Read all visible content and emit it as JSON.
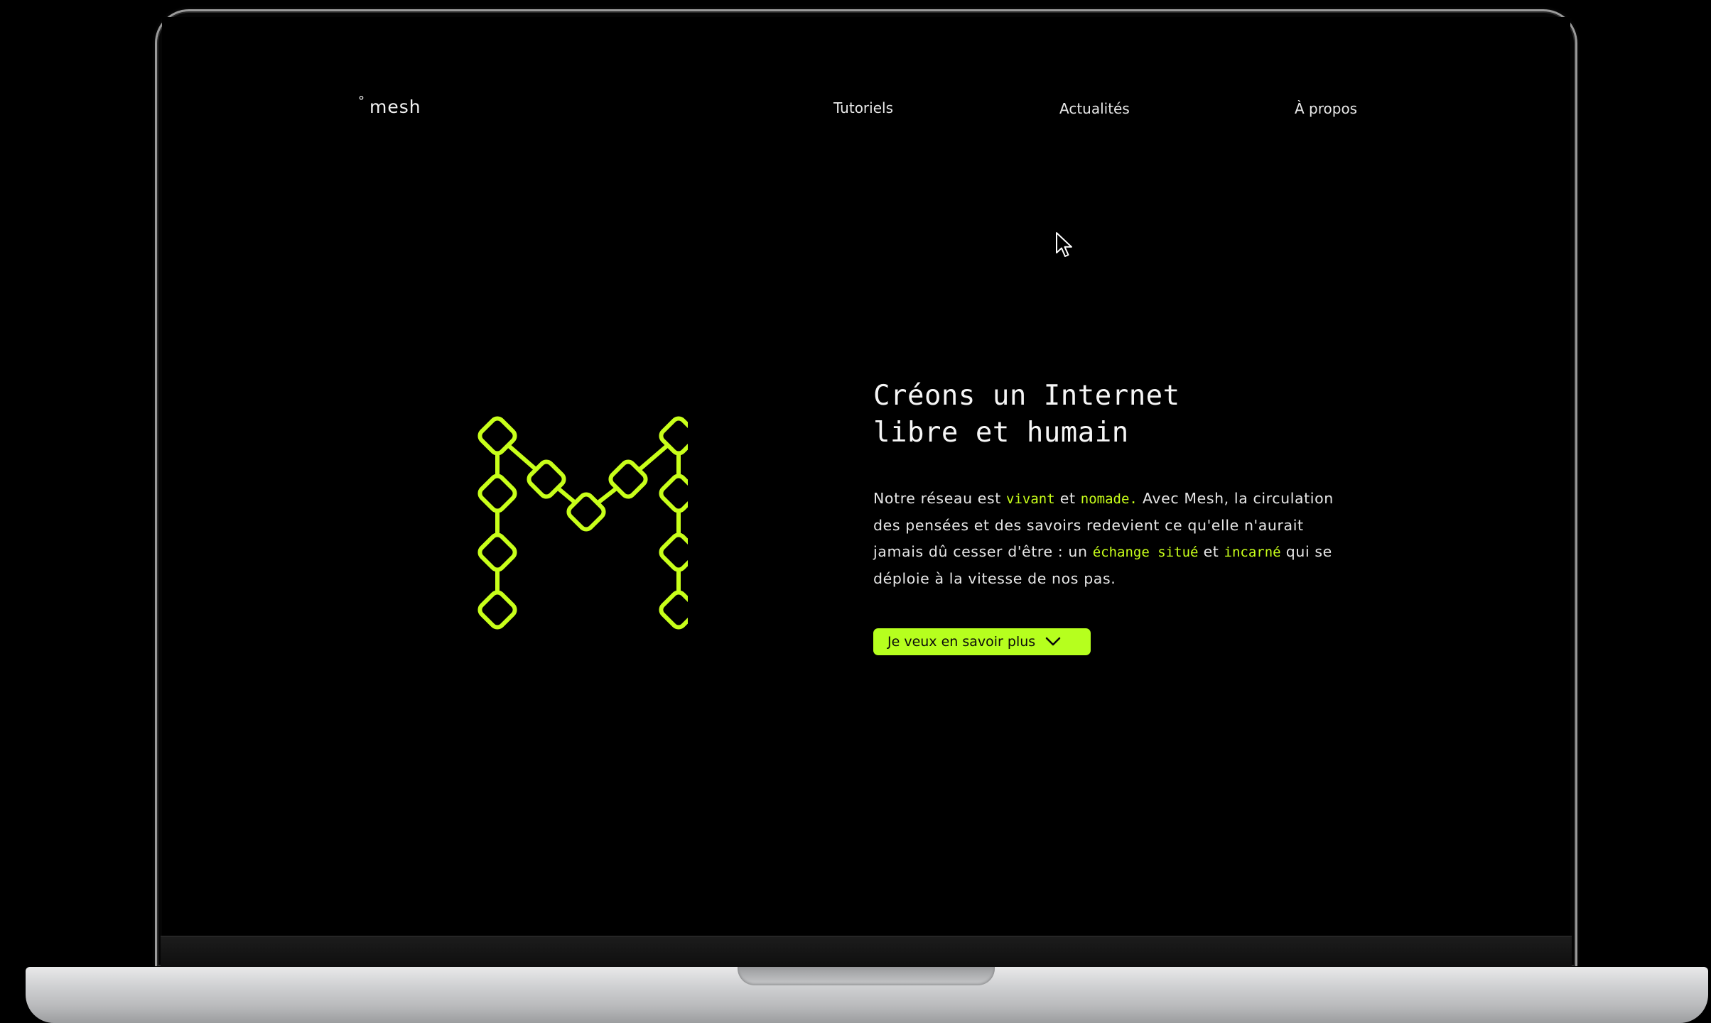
{
  "site": {
    "logo_mark": "°",
    "logo_text": "mesh"
  },
  "nav": {
    "items": [
      {
        "label": "Tutoriels"
      },
      {
        "label": "Actualités"
      },
      {
        "label": "À propos"
      }
    ]
  },
  "hero": {
    "title_line1": "Créons un Internet",
    "title_line2": "libre et humain",
    "body": {
      "p1": "Notre réseau est ",
      "hl1": "vivant",
      "p2": " et ",
      "hl2": "nomade.",
      "p3": " Avec Mesh, la circulation des pensées et des savoirs redevient ce qu'elle n'aurait jamais dû cesser d'être : un ",
      "hl3": "échange situé",
      "p4": " et ",
      "hl4": "incarné",
      "p5": " qui se déploie à la vitesse de nos pas."
    },
    "cta_label": "Je veux en savoir plus"
  },
  "icons": {
    "logo": "mesh-m-network-icon",
    "cta": "chevron-down-icon",
    "cursor": "mouse-pointer-icon"
  },
  "colors": {
    "background": "#000000",
    "accent": "#b6ff1e",
    "text": "#f5f5f5"
  }
}
